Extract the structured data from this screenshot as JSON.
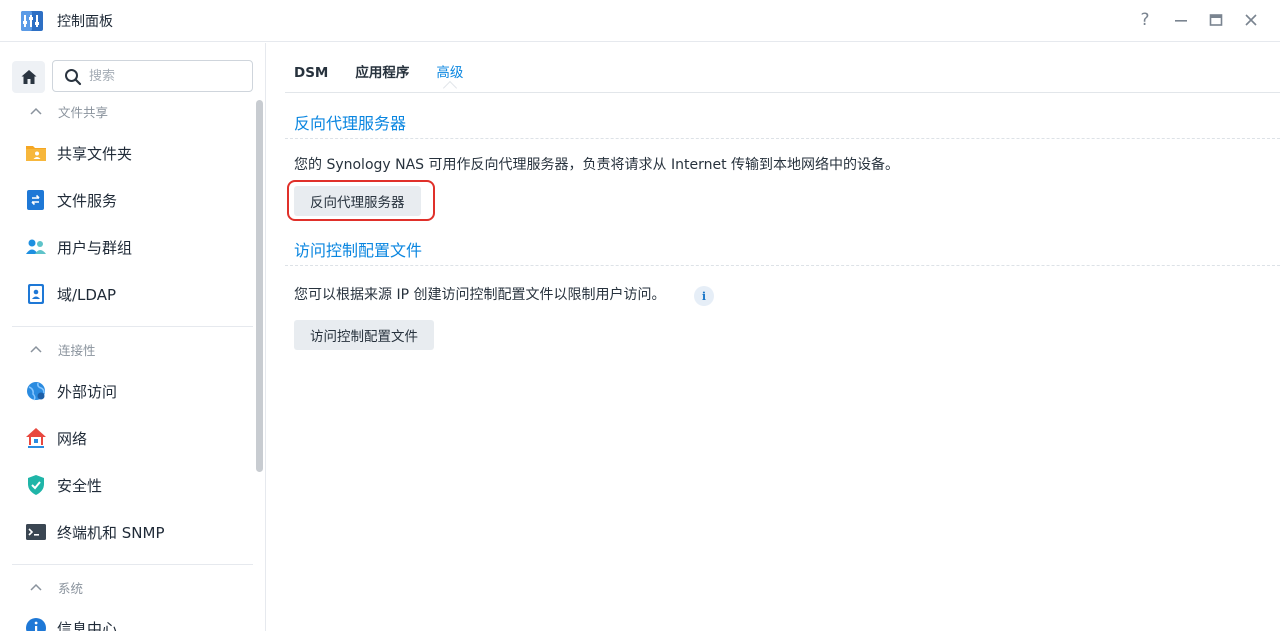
{
  "window": {
    "title": "控制面板",
    "controls": {
      "help": "?",
      "minimize": "—",
      "maximize": "□",
      "close": "✕"
    }
  },
  "sidebar": {
    "search_placeholder": "搜索",
    "sections": [
      {
        "title": "文件共享",
        "items": [
          {
            "label": "共享文件夹",
            "icon": "shared-folder-icon"
          },
          {
            "label": "文件服务",
            "icon": "file-services-icon"
          },
          {
            "label": "用户与群组",
            "icon": "users-groups-icon"
          },
          {
            "label": "域/LDAP",
            "icon": "domain-ldap-icon"
          }
        ]
      },
      {
        "title": "连接性",
        "items": [
          {
            "label": "外部访问",
            "icon": "external-access-icon"
          },
          {
            "label": "网络",
            "icon": "network-icon"
          },
          {
            "label": "安全性",
            "icon": "security-shield-icon"
          },
          {
            "label": "终端机和 SNMP",
            "icon": "terminal-icon"
          }
        ]
      },
      {
        "title": "系统",
        "items": [
          {
            "label": "信息中心",
            "icon": "info-center-icon"
          }
        ]
      }
    ]
  },
  "main": {
    "tabs": [
      {
        "label": "DSM",
        "active": false
      },
      {
        "label": "应用程序",
        "active": false
      },
      {
        "label": "高级",
        "active": true
      }
    ],
    "reverse_proxy": {
      "title": "反向代理服务器",
      "description": "您的 Synology NAS 可用作反向代理服务器，负责将请求从 Internet 传输到本地网络中的设备。",
      "button": "反向代理服务器"
    },
    "access_control": {
      "title": "访问控制配置文件",
      "description": "您可以根据来源 IP 创建访问控制配置文件以限制用户访问。",
      "info_icon": "i",
      "button": "访问控制配置文件"
    }
  },
  "colors": {
    "accent": "#0a86e0",
    "highlight_border": "#e0302a",
    "button_bg": "#e8ecf0"
  }
}
